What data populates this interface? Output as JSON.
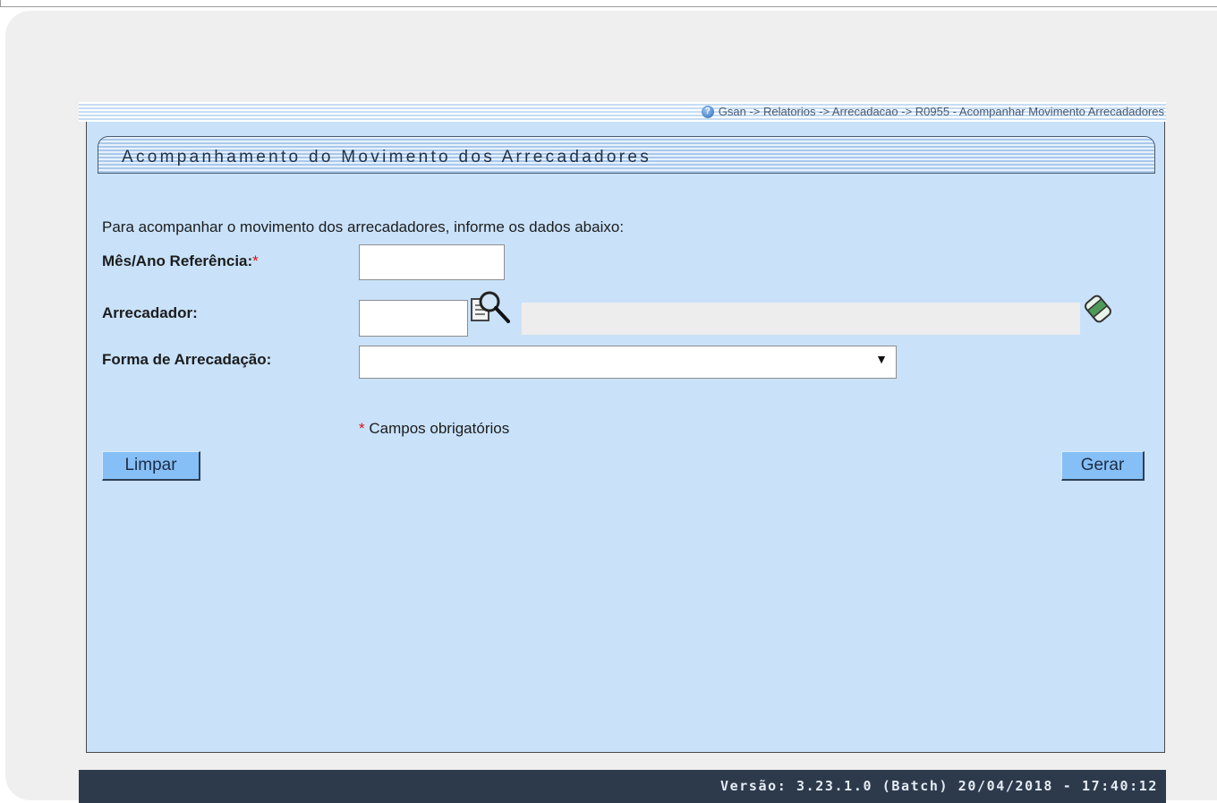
{
  "breadcrumb": "Gsan -> Relatorios -> Arrecadacao -> R0955 - Acompanhar Movimento Arrecadadores",
  "page_title": "Acompanhamento do Movimento dos Arrecadadores",
  "intro_text": "Para acompanhar o movimento dos arrecadadores, informe os dados abaixo:",
  "form": {
    "mes_ano_label": "Mês/Ano Referência:",
    "required_marker": "*",
    "mes_ano_value": "",
    "arrecadador_label": "Arrecadador:",
    "arrecadador_code": "",
    "arrecadador_name": "",
    "forma_label": "Forma de Arrecadação:",
    "forma_selected": ""
  },
  "required_note": "Campos obrigatórios",
  "buttons": {
    "limpar": "Limpar",
    "gerar": "Gerar"
  },
  "footer_version": "Versão: 3.23.1.0 (Batch) 20/04/2018 - 17:40:12",
  "icons": {
    "help": "help-icon",
    "search": "search-icon",
    "eraser": "eraser-icon",
    "dropdown": "chevron-down-icon"
  },
  "colors": {
    "content_bg": "#c9e2fa",
    "button_bg": "#86bff6",
    "footer_bg": "#2d3a4b",
    "required": "#dd1111"
  }
}
